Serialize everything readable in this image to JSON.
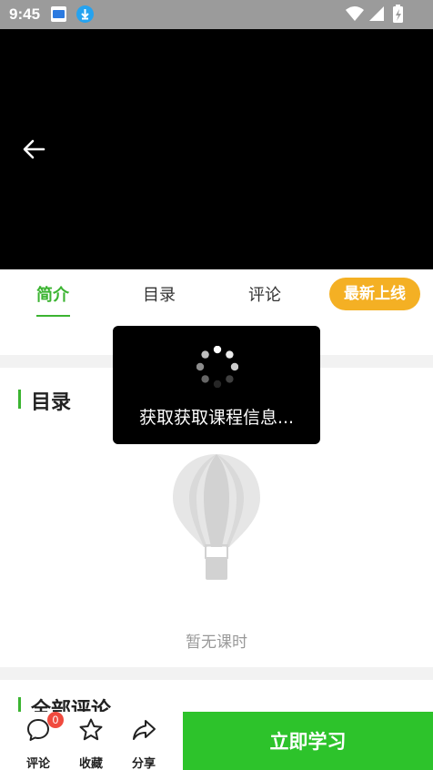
{
  "status_bar": {
    "time": "9:45",
    "icons": [
      "app-notification-icon",
      "download-icon",
      "wifi-icon",
      "signal-icon",
      "battery-charging-icon"
    ]
  },
  "colors": {
    "accent": "#3bb431",
    "badge": "#f4b024",
    "cta": "#2dc32b",
    "notify": "#f04a3e"
  },
  "tabs": [
    {
      "label": "简介",
      "active": true
    },
    {
      "label": "目录",
      "active": false
    },
    {
      "label": "评论",
      "active": false
    }
  ],
  "new_badge": "最新上线",
  "catalog": {
    "title": "目录",
    "empty_text": "暂无课时"
  },
  "comments_section": {
    "title": "全部评论"
  },
  "loading": {
    "text": "获取获取课程信息..."
  },
  "bottom_bar": {
    "comment_label": "评论",
    "comment_count": "0",
    "favorite_label": "收藏",
    "share_label": "分享",
    "study_label": "立即学习"
  }
}
